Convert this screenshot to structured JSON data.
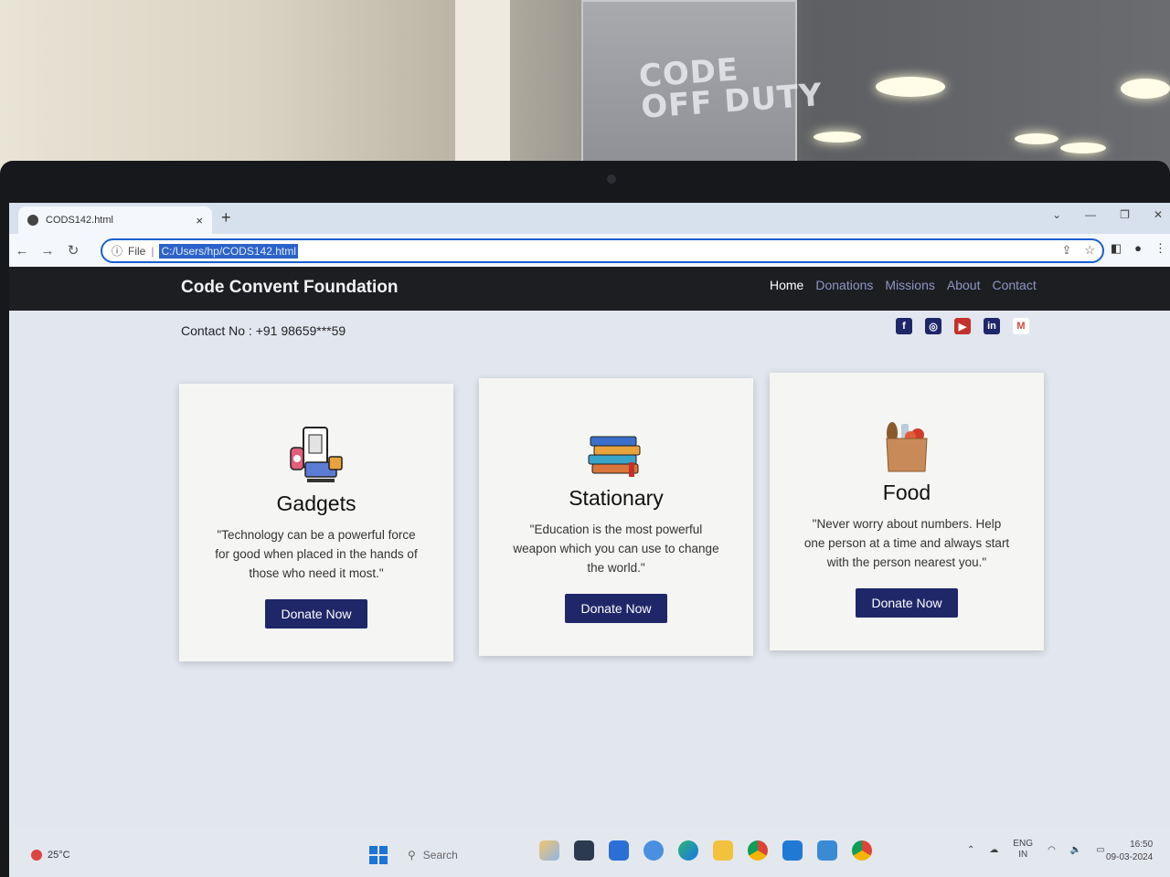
{
  "browser": {
    "tab_title": "CODS142.html",
    "tab_close": "×",
    "new_tab": "+",
    "address_prefix": "File",
    "url": "C:/Users/hp/CODS142.html"
  },
  "site": {
    "brand": "Code Convent Foundation",
    "nav": [
      {
        "label": "Home"
      },
      {
        "label": "Donations"
      },
      {
        "label": "Missions"
      },
      {
        "label": "About"
      },
      {
        "label": "Contact"
      }
    ],
    "contact": "Contact No : +91 98659***59",
    "socials": [
      {
        "icon": "facebook-icon",
        "glyph": "f",
        "color": "#1f2769"
      },
      {
        "icon": "instagram-icon",
        "glyph": "◎",
        "color": "#1f2769"
      },
      {
        "icon": "youtube-icon",
        "glyph": "▶",
        "color": "#c4302b"
      },
      {
        "icon": "linkedin-icon",
        "glyph": "in",
        "color": "#1f2769"
      },
      {
        "icon": "gmail-icon",
        "glyph": "M",
        "color": "#d24a3a"
      }
    ],
    "cards": [
      {
        "icon": "gadgets-icon",
        "title": "Gadgets",
        "quote": "\"Technology can be a powerful force for good when placed in the hands of those who need it most.\"",
        "button": "Donate Now"
      },
      {
        "icon": "books-icon",
        "title": "Stationary",
        "quote": "\"Education is the most powerful weapon which you can use to change the world.\"",
        "button": "Donate Now"
      },
      {
        "icon": "grocery-bag-icon",
        "title": "Food",
        "quote": "\"Never worry about numbers. Help one person at a time and always start with the person nearest you.\"",
        "button": "Donate Now"
      }
    ],
    "accent": "#1f2769",
    "navbar_color": "#1d1e22"
  },
  "taskbar": {
    "weather": "25°C",
    "search_placeholder": "Search",
    "lang_top": "ENG",
    "lang_bottom": "IN",
    "time": "16:50",
    "date": "09-03-2024"
  },
  "background": {
    "projector_text_1": "CODE",
    "projector_text_2": "OFF DUTY"
  }
}
